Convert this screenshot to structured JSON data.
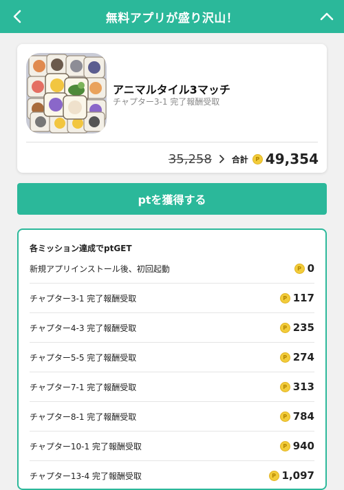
{
  "header": {
    "title": "無料アプリが盛り沢山！",
    "back_icon": "chevron-left-icon",
    "collapse_icon": "chevron-up-icon",
    "color": "#2bb89a"
  },
  "app": {
    "name": "アニマルタイル3マッチ",
    "subtitle": "チャプター3-1 完了報酬受取",
    "old_points": "35,258",
    "total_label": "合計",
    "total_points": "49,354",
    "coin_symbol": "P"
  },
  "cta": {
    "label": "ptを獲得する"
  },
  "missions": {
    "heading": "各ミッション達成でptGET",
    "items": [
      {
        "label": "新規アプリインストール後、初回起動",
        "points": "0"
      },
      {
        "label": "チャプター3-1 完了報酬受取",
        "points": "117"
      },
      {
        "label": "チャプター4-3 完了報酬受取",
        "points": "235"
      },
      {
        "label": "チャプター5-5 完了報酬受取",
        "points": "274"
      },
      {
        "label": "チャプター7-1 完了報酬受取",
        "points": "313"
      },
      {
        "label": "チャプター8-1 完了報酬受取",
        "points": "784"
      },
      {
        "label": "チャプター10-1 完了報酬受取",
        "points": "940"
      },
      {
        "label": "チャプター13-4 完了報酬受取",
        "points": "1,097"
      }
    ]
  }
}
